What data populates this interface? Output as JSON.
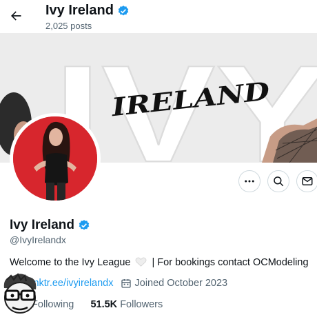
{
  "header": {
    "name": "Ivy Ireland",
    "posts": "2,025 posts"
  },
  "banner": {
    "big_text": "IVY",
    "script_text": "IRELAND"
  },
  "actions": [
    {
      "icon": "more-icon"
    },
    {
      "icon": "search-icon"
    },
    {
      "icon": "message-icon"
    }
  ],
  "profile": {
    "name": "Ivy Ireland",
    "handle": "@IvyIrelandx",
    "bio_before": "Welcome to the Ivy League",
    "bio_after": "| For bookings contact OCModeling",
    "link": "linktr.ee/ivyirelandx",
    "joined": "Joined October 2023",
    "following_label": "Following",
    "followers_count": "51.5K",
    "followers_label": "Followers"
  },
  "colors": {
    "accent": "#1d9bf0",
    "secondary_text": "#536471",
    "avatar_bg": "#d7262d"
  }
}
